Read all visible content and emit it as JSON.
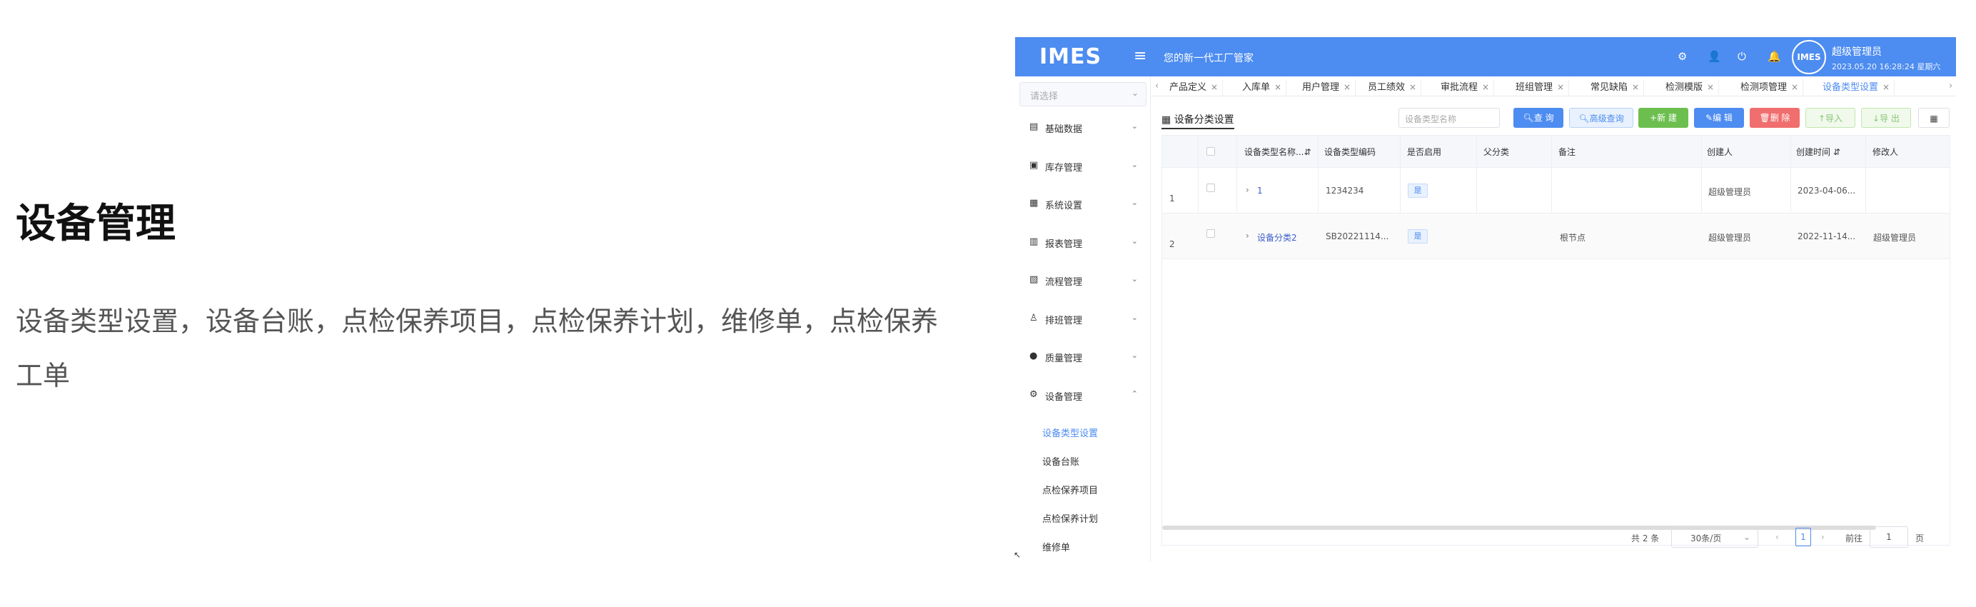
{
  "hero": {
    "title": "设备管理",
    "description": "设备类型设置，设备台账，点检保养项目，点检保养计划，维修单，点检保养工单"
  },
  "app": {
    "logo": "IMES",
    "slogan": "您的新一代工厂管家",
    "user": {
      "avatar_text": "IMES",
      "name": "超级管理员",
      "datetime": "2023.05.20 16:28:24 星期六"
    },
    "icons": [
      "gear-icon",
      "user-icon",
      "power-icon",
      "bell-icon"
    ],
    "accent_color": "#4d8cf0"
  },
  "sidebar": {
    "select_placeholder": "请选择",
    "menu": [
      {
        "label": "基础数据",
        "icon": "document-icon",
        "arrow": "⌄"
      },
      {
        "label": "库存管理",
        "icon": "clipboard-icon",
        "arrow": "⌄"
      },
      {
        "label": "系统设置",
        "icon": "grid-icon",
        "arrow": "⌄"
      },
      {
        "label": "报表管理",
        "icon": "bar-chart-icon",
        "arrow": "⌄"
      },
      {
        "label": "流程管理",
        "icon": "flow-icon",
        "arrow": "⌄"
      },
      {
        "label": "排班管理",
        "icon": "person-icon",
        "arrow": "⌄"
      },
      {
        "label": "质量管理",
        "icon": "alert-icon",
        "arrow": "⌄"
      },
      {
        "label": "设备管理",
        "icon": "settings-icon",
        "arrow": "⌃"
      }
    ],
    "submenu": [
      {
        "label": "设备类型设置",
        "active": true
      },
      {
        "label": "设备台账",
        "active": false
      },
      {
        "label": "点检保养项目",
        "active": false
      },
      {
        "label": "点检保养计划",
        "active": false
      },
      {
        "label": "维修单",
        "active": false
      }
    ]
  },
  "tabs": [
    {
      "label": "产品定义",
      "active": false
    },
    {
      "label": "入库单",
      "active": false
    },
    {
      "label": "用户管理",
      "active": false
    },
    {
      "label": "员工绩效",
      "active": false
    },
    {
      "label": "审批流程",
      "active": false
    },
    {
      "label": "班组管理",
      "active": false
    },
    {
      "label": "常见缺陷",
      "active": false
    },
    {
      "label": "检测模版",
      "active": false
    },
    {
      "label": "检测项管理",
      "active": false
    },
    {
      "label": "设备类型设置",
      "active": true
    }
  ],
  "content": {
    "section_title": "设备分类设置",
    "search_placeholder": "设备类型名称",
    "buttons": {
      "query": "查 询",
      "advanced": "高级查询",
      "create": "新 建",
      "edit": "编 辑",
      "delete": "删 除",
      "import": "导入",
      "export": "导 出"
    },
    "table": {
      "columns": [
        "设备类型名称",
        "设备类型编码",
        "是否启用",
        "父分类",
        "备注",
        "创建人",
        "创建时间",
        "修改人"
      ],
      "rows": [
        {
          "index": "1",
          "name": "1",
          "code": "1234234",
          "enabled": "是",
          "parent": "",
          "remark": "",
          "creator": "超级管理员",
          "created": "2023-04-06...",
          "modifier": ""
        },
        {
          "index": "2",
          "name": "设备分类2",
          "code": "SB20221114...",
          "enabled": "是",
          "parent": "",
          "remark": "根节点",
          "creator": "超级管理员",
          "created": "2022-11-14...",
          "modifier": "超级管理员"
        }
      ]
    },
    "pager": {
      "total": "共 2 条",
      "page_size": "30条/页",
      "current_page": "1",
      "goto_label": "前往",
      "goto_value": "1",
      "page_unit": "页"
    }
  }
}
